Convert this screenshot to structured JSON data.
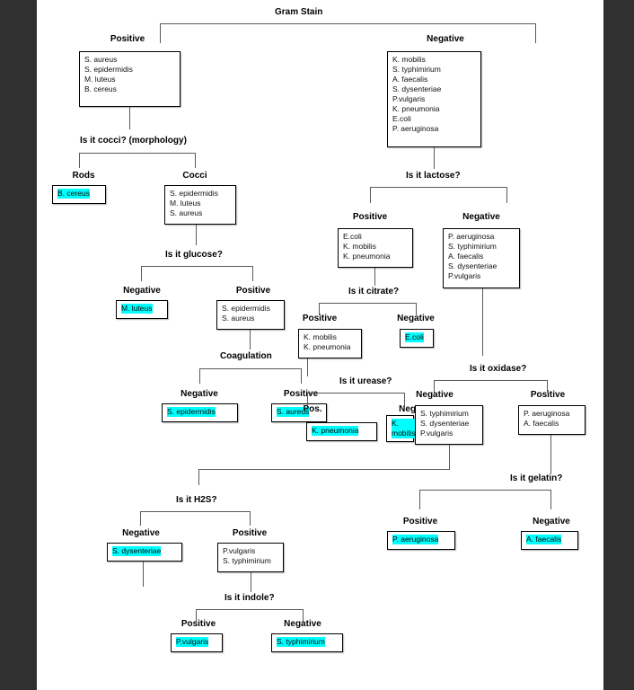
{
  "diagram": {
    "title": "Gram Stain",
    "highlight_color": "#00ffff",
    "page_background": "#ffffff",
    "margin_color": "#303030",
    "questions": {
      "gram_stain": "Gram Stain",
      "cocci": "Is it cocci? (morphology)",
      "glucose": "Is it glucose?",
      "coagulation": "Coagulation",
      "lactose": "Is it lactose?",
      "citrate": "Is it citrate?",
      "urease": "Is it urease?",
      "oxidase": "Is it oxidase?",
      "h2s": "Is it H2S?",
      "indole": "Is it indole?",
      "gelatin": "Is it gelatin?"
    },
    "branch_labels": {
      "gram_positive": "Positive",
      "gram_negative": "Negative",
      "rods": "Rods",
      "cocci": "Cocci",
      "glucose_negative": "Negative",
      "glucose_positive": "Positive",
      "coagulation_negative": "Negative",
      "coagulation_positive": "Positive",
      "lactose_positive": "Positive",
      "lactose_negative": "Negative",
      "citrate_positive": "Positive",
      "citrate_negative": "Negative",
      "urease_positive": "Pos.",
      "urease_negative": "Neg.",
      "oxidase_negative": "Negative",
      "oxidase_positive": "Positive",
      "h2s_negative": "Negative",
      "h2s_positive": "Positive",
      "indole_positive": "Positive",
      "indole_negative": "Negative",
      "gelatin_positive": "Positive",
      "gelatin_negative": "Negative"
    },
    "boxes": {
      "gram_positive": [
        "S. aureus",
        "S. epidermidis",
        "M. luteus",
        "B. cereus"
      ],
      "gram_negative": [
        "K. mobilis",
        "S. typhimirium",
        "A. faecalis",
        "S. dysenteriae",
        "P.vulgaris",
        "K. pneumonia",
        "E.coli",
        "P. aeruginosa"
      ],
      "rods": [
        "B. cereus"
      ],
      "cocci": [
        "S. epidermidis",
        "M. luteus",
        "S. aureus"
      ],
      "glucose_negative": [
        "M. luteus"
      ],
      "glucose_positive": [
        "S. epidermidis",
        "S. aureus"
      ],
      "coagulation_negative": [
        "S. epidermidis"
      ],
      "coagulation_positive": [
        "S. aureus"
      ],
      "lactose_positive": [
        "E.coli",
        "K. mobilis",
        "K. pneumonia"
      ],
      "lactose_negative": [
        "P. aeruginosa",
        "S. typhimirium",
        "A. faecalis",
        "S. dysenteriae",
        "P.vulgaris"
      ],
      "citrate_positive": [
        "K. mobilis",
        "K. pneumonia"
      ],
      "citrate_negative": [
        "E.coli"
      ],
      "urease_positive": [
        "K. pneumonia"
      ],
      "urease_negative": [
        "K. mobilis"
      ],
      "oxidase_negative": [
        "S. typhimirium",
        "S. dysenteriae",
        "P.vulgaris"
      ],
      "oxidase_positive": [
        "P. aeruginosa",
        "A. faecalis"
      ],
      "h2s_negative": [
        "S. dysenteriae"
      ],
      "h2s_positive": [
        "P.vulgaris",
        "S. typhimirium"
      ],
      "indole_positive": [
        "P.vulgaris"
      ],
      "indole_negative": [
        "S. typhimirium"
      ],
      "gelatin_positive": [
        "P. aeruginosa"
      ],
      "gelatin_negative": [
        "A. faecalis"
      ]
    },
    "highlighted_boxes": [
      "rods",
      "glucose_negative",
      "coagulation_negative",
      "coagulation_positive",
      "citrate_negative",
      "urease_positive",
      "urease_negative",
      "h2s_negative",
      "indole_positive",
      "indole_negative",
      "gelatin_positive",
      "gelatin_negative"
    ]
  }
}
